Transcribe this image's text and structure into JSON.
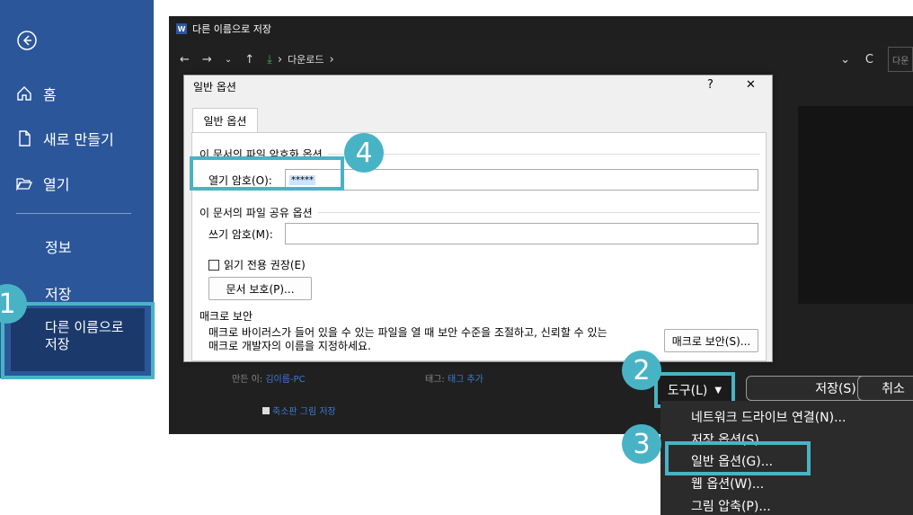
{
  "sidebar": {
    "home": "홈",
    "new": "새로 만들기",
    "open": "열기",
    "info": "정보",
    "save": "저장",
    "save_as": "다른 이름으로 저장"
  },
  "saveas": {
    "title": "다른 이름으로 저장",
    "breadcrumb": "다운로드",
    "search_placeholder": "다운",
    "author_label": "만든 이:",
    "author_value": "김이름-PC",
    "tags_label": "태그:",
    "tags_value": "태그 추가",
    "thumbnail_label": "축소판 그림 저장",
    "tools_label": "도구(L)",
    "save_button": "저장(S)",
    "cancel_button": "취소"
  },
  "tools_menu": {
    "items": [
      "네트워크 드라이브 연결(N)...",
      "저장 옵션(S)...",
      "일반 옵션(G)...",
      "웹 옵션(W)...",
      "그림 압축(P)..."
    ]
  },
  "dialog": {
    "title": "일반 옵션",
    "help": "?",
    "close": "✕",
    "tab": "일반 옵션",
    "encrypt_group": "이 문서의 파일 암호화 옵션",
    "open_password_label": "열기 암호(O):",
    "open_password_value": "*****",
    "share_group": "이 문서의 파일 공유 옵션",
    "write_password_label": "쓰기 암호(M):",
    "readonly_label": "읽기 전용 권장(E)",
    "protect_button": "문서 보호(P)...",
    "macro_group": "매크로 보안",
    "macro_text_1": "매크로 바이러스가 들어 있을 수 있는 파일을 열 때 보안 수준을 조절하고, 신뢰할 수 있는",
    "macro_text_2": "매크로 개발자의 이름을 지정하세요.",
    "macro_button": "매크로 보안(S)..."
  },
  "badges": [
    "1",
    "2",
    "3",
    "4"
  ],
  "colors": {
    "sidebar": "#2b579a",
    "highlight": "#49b3c6"
  }
}
